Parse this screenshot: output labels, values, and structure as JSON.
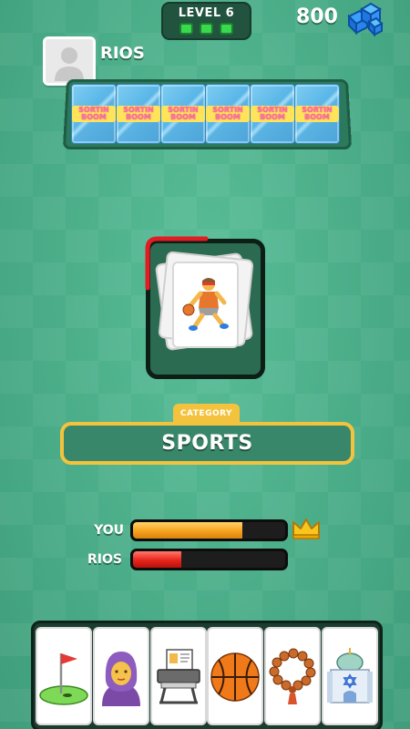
{
  "level": {
    "label": "LEVEL 6",
    "stages_total": 3,
    "stages_done": 3
  },
  "gems": {
    "count": "800",
    "icon": "gem-icon"
  },
  "opponent": {
    "name": "RIOS",
    "avatar_icon": "avatar-placeholder-icon",
    "cards_face_down": 6,
    "card_back_text": "SORTIN BOOM"
  },
  "pile": {
    "top_card_icon": "basketball-player-icon",
    "timer_color": "#e31b23"
  },
  "category": {
    "label": "CATEGORY",
    "value": "SPORTS"
  },
  "progress": {
    "you": {
      "label": "YOU",
      "fraction": 0.72,
      "color": "#f6a21d",
      "leader_icon": "crown-icon"
    },
    "opponent": {
      "label": "RIOS",
      "fraction": 0.32,
      "color": "#e8231a"
    }
  },
  "hand": {
    "cards": [
      {
        "icon": "golf-flag-icon"
      },
      {
        "icon": "woman-hijab-icon"
      },
      {
        "icon": "id-card-printer-icon"
      },
      {
        "icon": "basketball-icon"
      },
      {
        "icon": "prayer-beads-icon"
      },
      {
        "icon": "synagogue-icon"
      }
    ]
  },
  "colors": {
    "background": "#4aae8a",
    "accent_gold": "#f4c33e",
    "level_pill": "#21533f"
  }
}
